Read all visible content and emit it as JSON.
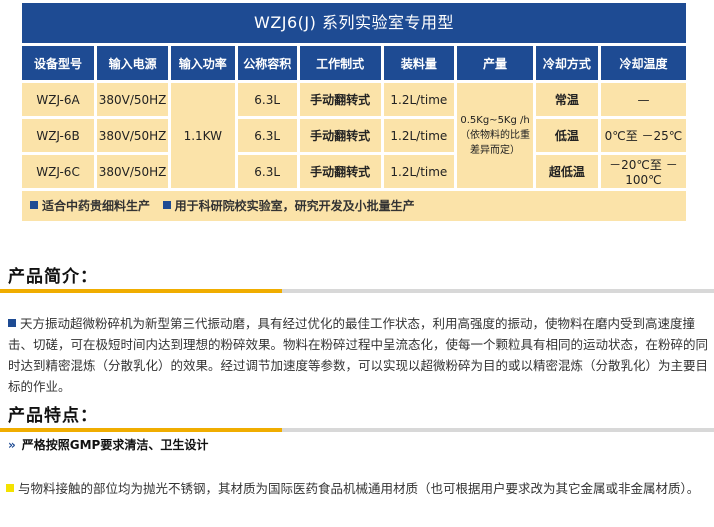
{
  "spec": {
    "title": "WZJ6(J) 系列实验室专用型",
    "headers": [
      "设备型号",
      "输入电源",
      "输入功率",
      "公称容积",
      "工作制式",
      "装料量",
      "产量",
      "冷却方式",
      "冷却温度"
    ],
    "shared": {
      "power": "1.1KW",
      "output": "0.5Kg~5Kg /h（依物料的比重差异而定）"
    },
    "rows": [
      {
        "model": "WZJ-6A",
        "supply": "380V/50HZ",
        "volume": "6.3L",
        "mode": "手动翻转式",
        "load": "1.2L/time",
        "cooling": "常温",
        "temp": "—"
      },
      {
        "model": "WZJ-6B",
        "supply": "380V/50HZ",
        "volume": "6.3L",
        "mode": "手动翻转式",
        "load": "1.2L/time",
        "cooling": "低温",
        "temp": "0℃至 －25℃"
      },
      {
        "model": "WZJ-6C",
        "supply": "380V/50HZ",
        "volume": "6.3L",
        "mode": "手动翻转式",
        "load": "1.2L/time",
        "cooling": "超低温",
        "temp": "－20℃至 －100℃"
      }
    ],
    "notes": [
      "适合中药贵细料生产",
      "用于科研院校实验室，研究开发及小批量生产"
    ]
  },
  "intro": {
    "title": "产品简介：",
    "text": "天方振动超微粉碎机为新型第三代振动磨，具有经过优化的最佳工作状态，利用高强度的振动，使物料在磨内受到高速度撞击、切磋，可在极短时间内达到理想的粉碎效果。物料在粉碎过程中呈流态化，使每一个颗粒具有相同的运动状态，在粉碎的同时达到精密混炼（分散乳化）的效果。经过调节加速度等参数，可以实现以超微粉碎为目的或以精密混炼（分散乳化）为主要目标的作业。"
  },
  "features": {
    "title": "产品特点：",
    "heading": "严格按照GMP要求清洁、卫生设计",
    "text": "与物料接触的部位均为抛光不锈钢，其材质为国际医药食品机械通用材质（也可根据用户要求改为其它金属或非金属材质）。"
  },
  "colors": {
    "header_blue": "#1e4b93",
    "cell_yellow": "#fbe3a9",
    "accent_orange": "#f0ad00"
  }
}
